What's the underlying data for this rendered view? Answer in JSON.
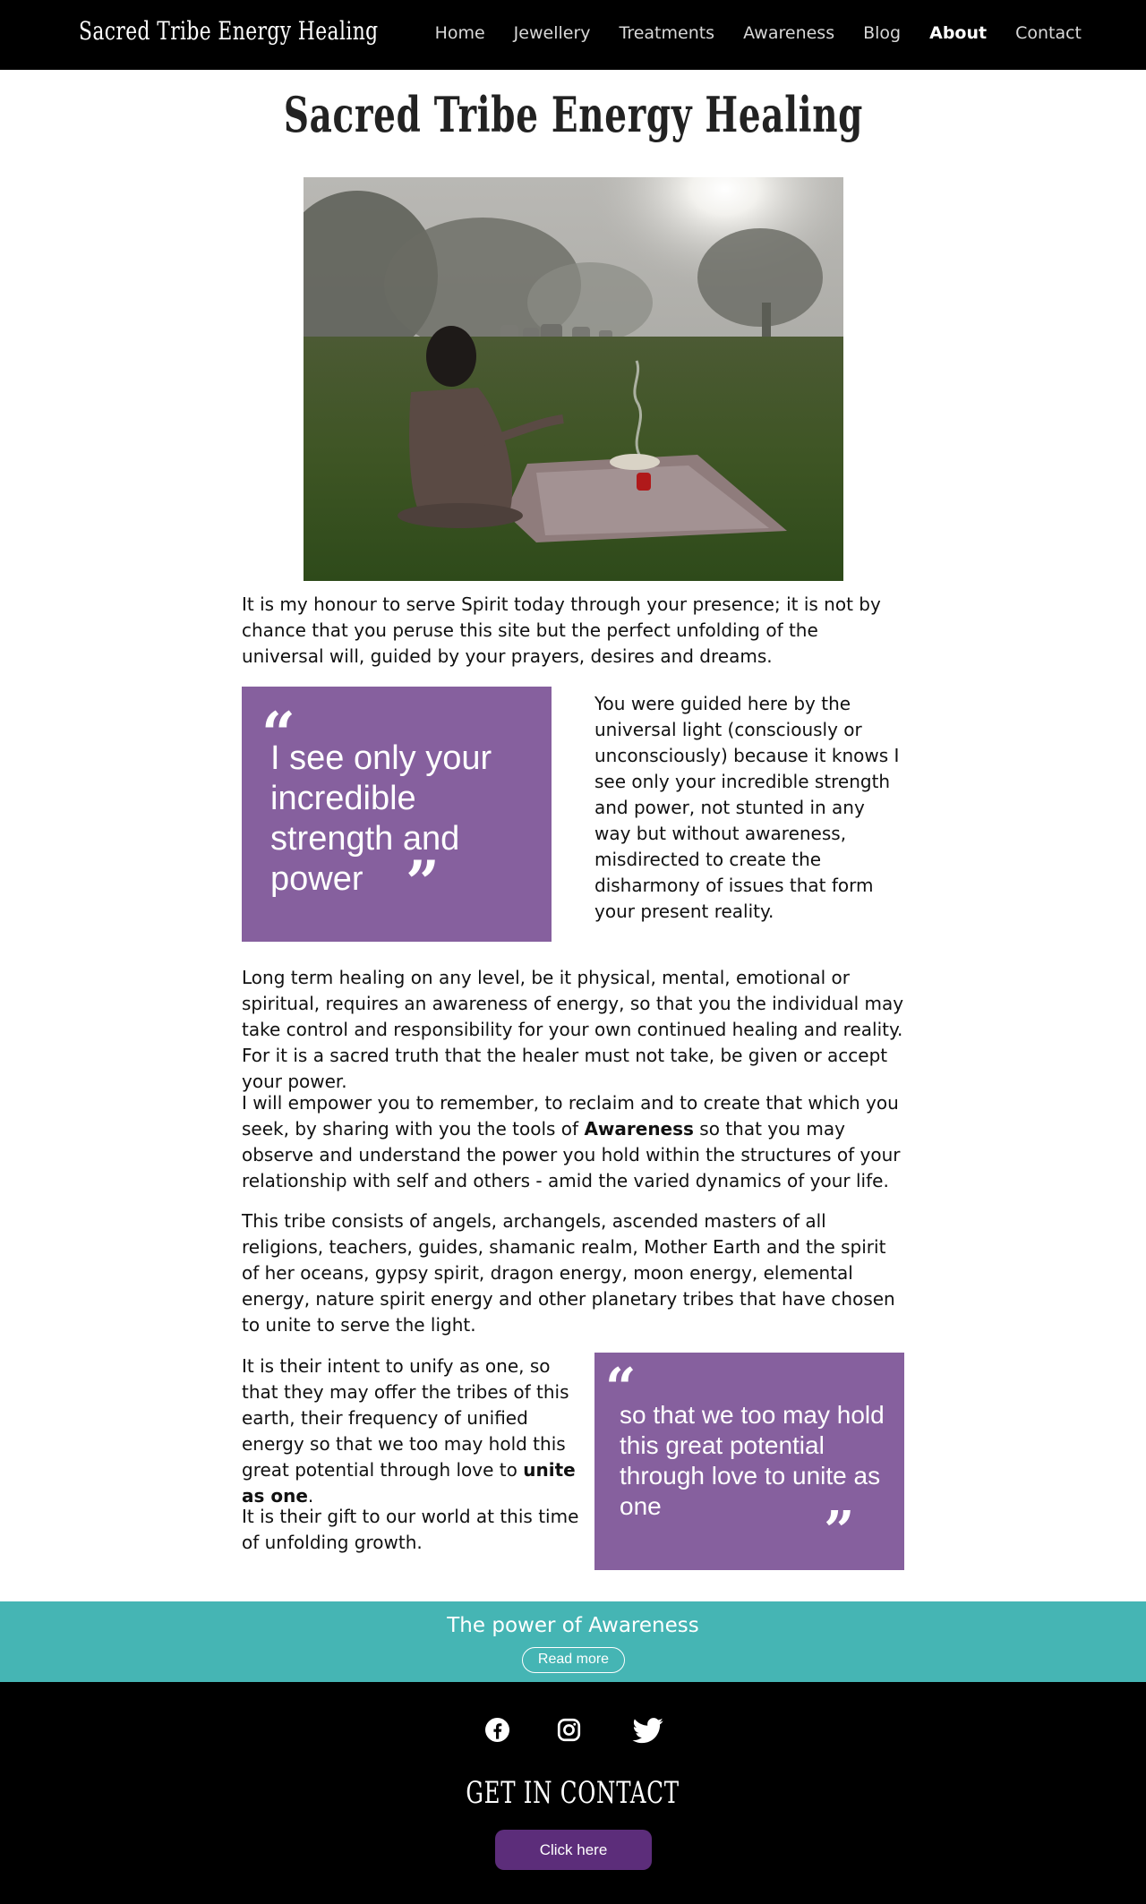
{
  "header": {
    "brand": "Sacred Tribe Energy Healing",
    "nav": [
      {
        "label": "Home"
      },
      {
        "label": "Jewellery"
      },
      {
        "label": "Treatments"
      },
      {
        "label": "Awareness"
      },
      {
        "label": "Blog"
      },
      {
        "label": "About",
        "active": true
      },
      {
        "label": "Contact"
      }
    ]
  },
  "main": {
    "title": "Sacred Tribe Energy Healing",
    "intro": "It is my honour to serve Spirit today through your presence; it is not by chance that you peruse this site but the perfect unfolding of the universal will, guided by your prayers, desires and dreams.",
    "quote1": "I see only your incredible strength and power",
    "side1": "You were guided here by the universal light (consciously or unconsciously) because it knows I see only your incredible strength and power, not stunted in any way but without awareness, misdirected to create the disharmony of issues that form your present reality.",
    "para2": "Long term healing on any level, be it physical, mental, emotional or spiritual, requires an awareness of energy, so that you the individual may take control and responsibility for your own continued healing and reality. For it is a sacred truth that the healer must not take, be given or accept your power.",
    "para3_before": "I will empower you to remember, to reclaim and to create that which you seek, by sharing with you the tools of ",
    "para3_bold": "Awareness",
    "para3_after": " so that you may observe and understand the power you hold within the structures of your relationship with self and others - amid the varied dynamics of your life.",
    "para4": "This tribe consists of angels, archangels, ascended masters of all religions, teachers, guides, shamanic realm, Mother Earth and the spirit of her oceans, gypsy spirit, dragon energy, moon energy, elemental energy, nature spirit energy and other planetary tribes that have chosen to unite to serve the light.",
    "para5_before": "It is their intent to unify as one, so that they may offer the tribes of this earth, their frequency of unified energy so that we too may hold this great potential through love to ",
    "para5_bold": "unite as one",
    "para5_after": ".",
    "para6": "It is their gift to our world at this time of unfolding growth.",
    "quote2": "so that we too may hold this great potential through love to unite as one",
    "quote_open": "“",
    "quote_close": "”"
  },
  "band": {
    "title": "The power of Awareness",
    "button": "Read more",
    "color": "#45b5b4"
  },
  "footer": {
    "social": [
      "facebook-icon",
      "instagram-icon",
      "twitter-icon"
    ],
    "contact_title": "GET IN CONTACT",
    "button": "Click here",
    "button_color": "#5c2d7a"
  },
  "colors": {
    "quote_box": "#86609e",
    "header_bg": "#000000"
  }
}
